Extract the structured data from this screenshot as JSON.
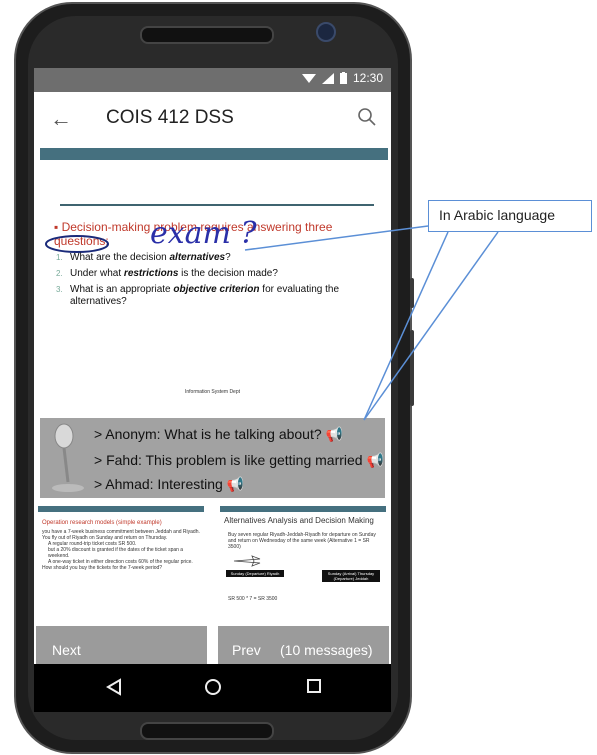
{
  "status_bar": {
    "time": "12:30"
  },
  "app_bar": {
    "title": "COIS 412 DSS"
  },
  "slide": {
    "bullet": "Decision-making problem requires answering three questions:",
    "questions": [
      {
        "num": "1.",
        "pre": "What are the decision ",
        "em": "alternatives",
        "post": "?"
      },
      {
        "num": "2.",
        "pre": "Under what ",
        "em": "restrictions",
        "post": " is the decision made?"
      },
      {
        "num": "3.",
        "pre": "What is an appropriate ",
        "em": "objective criterion",
        "post": " for evaluating the alternatives?"
      }
    ],
    "footer": "Information System Dept"
  },
  "handwritten_note": "exam ?",
  "callout": {
    "label": "In Arabic language"
  },
  "comments": [
    {
      "text": "> Anonym: What is he talking about?",
      "icon": "megaphone-icon"
    },
    {
      "text": "> Fahd: This problem is like getting married",
      "icon": "megaphone-icon"
    },
    {
      "text": "> Ahmad: Interesting",
      "icon": "megaphone-icon"
    }
  ],
  "thumb_left": {
    "title": "Operation research models (simple example)",
    "lines": [
      "you have a 7-week business commitment between Jeddah and Riyadh. You fly out of Riyadh on Sunday and return on Thursday.",
      "A regular round-trip ticket costs SR 500.",
      "but a 20% discount is granted if the dates of the ticket span a weekend.",
      "A one-way ticket in either direction costs 60% of the regular price.",
      "How should you buy the tickets for the 7-week period?"
    ]
  },
  "thumb_right": {
    "title": "Alternatives Analysis and Decision Making",
    "line1": "Buy seven regular Riyadh-Jeddah-Riyadh for departure on Sunday and return on Wednesday of the same week (Alternative 1 = SR 3500)",
    "box1": "Sunday (Departure) Riyadh",
    "box2": "Sunday (Arrival) Thursday (Departure) Jeddah",
    "calc": "SR 500 * 7 = SR 3500"
  },
  "nav_buttons": {
    "next": "Next",
    "prev": "Prev",
    "messages": "(10 messages)"
  },
  "colors": {
    "slide_bar": "#45707f",
    "comment_bg": "#a2a2a2",
    "button_bg": "#9b9b9b",
    "bullet_red": "#c0392b",
    "callout_border": "#5b8fd6"
  }
}
